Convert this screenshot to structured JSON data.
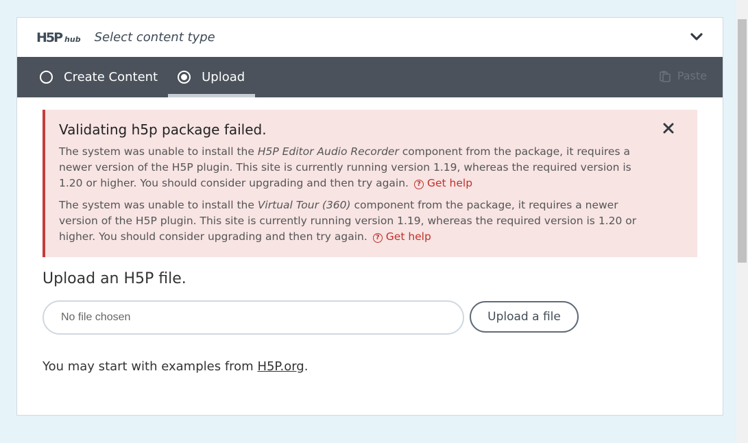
{
  "hub": {
    "logo_main": "H5P",
    "logo_sub": "hub",
    "title": "Select content type",
    "chevron_icon": "chevron-down-icon"
  },
  "tabs": [
    {
      "label": "Create Content",
      "selected": false
    },
    {
      "label": "Upload",
      "selected": true
    }
  ],
  "paste": {
    "label": "Paste",
    "icon": "clipboard-icon",
    "enabled": false
  },
  "alert": {
    "title": "Validating h5p package failed.",
    "messages": [
      {
        "before": "The system was unable to install the ",
        "component": "H5P Editor Audio Recorder",
        "after": " component from the package, it requires a newer version of the H5P plugin. This site is currently running version 1.19, whereas the required version is 1.20 or higher. You should consider upgrading and then try again.",
        "help_label": "Get help"
      },
      {
        "before": "The system was unable to install the ",
        "component": "Virtual Tour (360)",
        "after": " component from the package, it requires a newer version of the H5P plugin. This site is currently running version 1.19, whereas the required version is 1.20 or higher. You should consider upgrading and then try again.",
        "help_label": "Get help"
      }
    ],
    "close_icon": "close-icon",
    "colors": {
      "background": "#f7e4e3",
      "border": "#c63c3c",
      "link": "#c0302b"
    }
  },
  "upload": {
    "heading": "Upload an H5P file.",
    "file_placeholder": "No file chosen",
    "button_label": "Upload a file"
  },
  "examples": {
    "prefix": "You may start with examples from ",
    "link_text": "H5P.org",
    "suffix": "."
  }
}
